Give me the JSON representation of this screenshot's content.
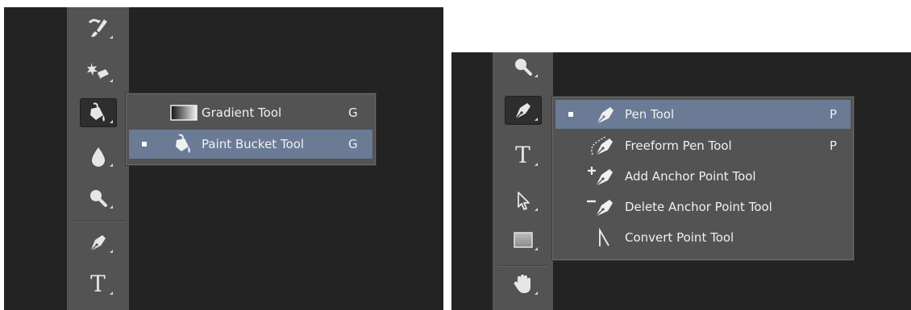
{
  "left_menu": {
    "items": [
      {
        "label": "Gradient Tool",
        "shortcut": "G",
        "selected": false
      },
      {
        "label": "Paint Bucket Tool",
        "shortcut": "G",
        "selected": true
      }
    ]
  },
  "right_menu": {
    "items": [
      {
        "label": "Pen Tool",
        "shortcut": "P",
        "selected": true
      },
      {
        "label": "Freeform Pen Tool",
        "shortcut": "P",
        "selected": false
      },
      {
        "label": "Add Anchor Point Tool",
        "shortcut": "",
        "selected": false
      },
      {
        "label": "Delete Anchor Point Tool",
        "shortcut": "",
        "selected": false
      },
      {
        "label": "Convert Point Tool",
        "shortcut": "",
        "selected": false
      }
    ]
  },
  "toolbar_left": {
    "tools": [
      "history-brush-icon",
      "eraser-icon",
      "paint-bucket-icon",
      "blur-icon",
      "dodge-icon",
      "pen-icon",
      "type-icon"
    ],
    "type_glyph": "T"
  },
  "toolbar_right": {
    "tools": [
      "dodge-icon",
      "pen-icon",
      "type-icon",
      "path-selection-icon",
      "rectangle-icon",
      "hand-icon"
    ],
    "type_glyph": "T"
  },
  "colors": {
    "panel_bg": "#232323",
    "toolbar_bg": "#535353",
    "menu_bg": "#535353",
    "selected_bg": "#6b7b96",
    "text": "#f0f0f0"
  }
}
